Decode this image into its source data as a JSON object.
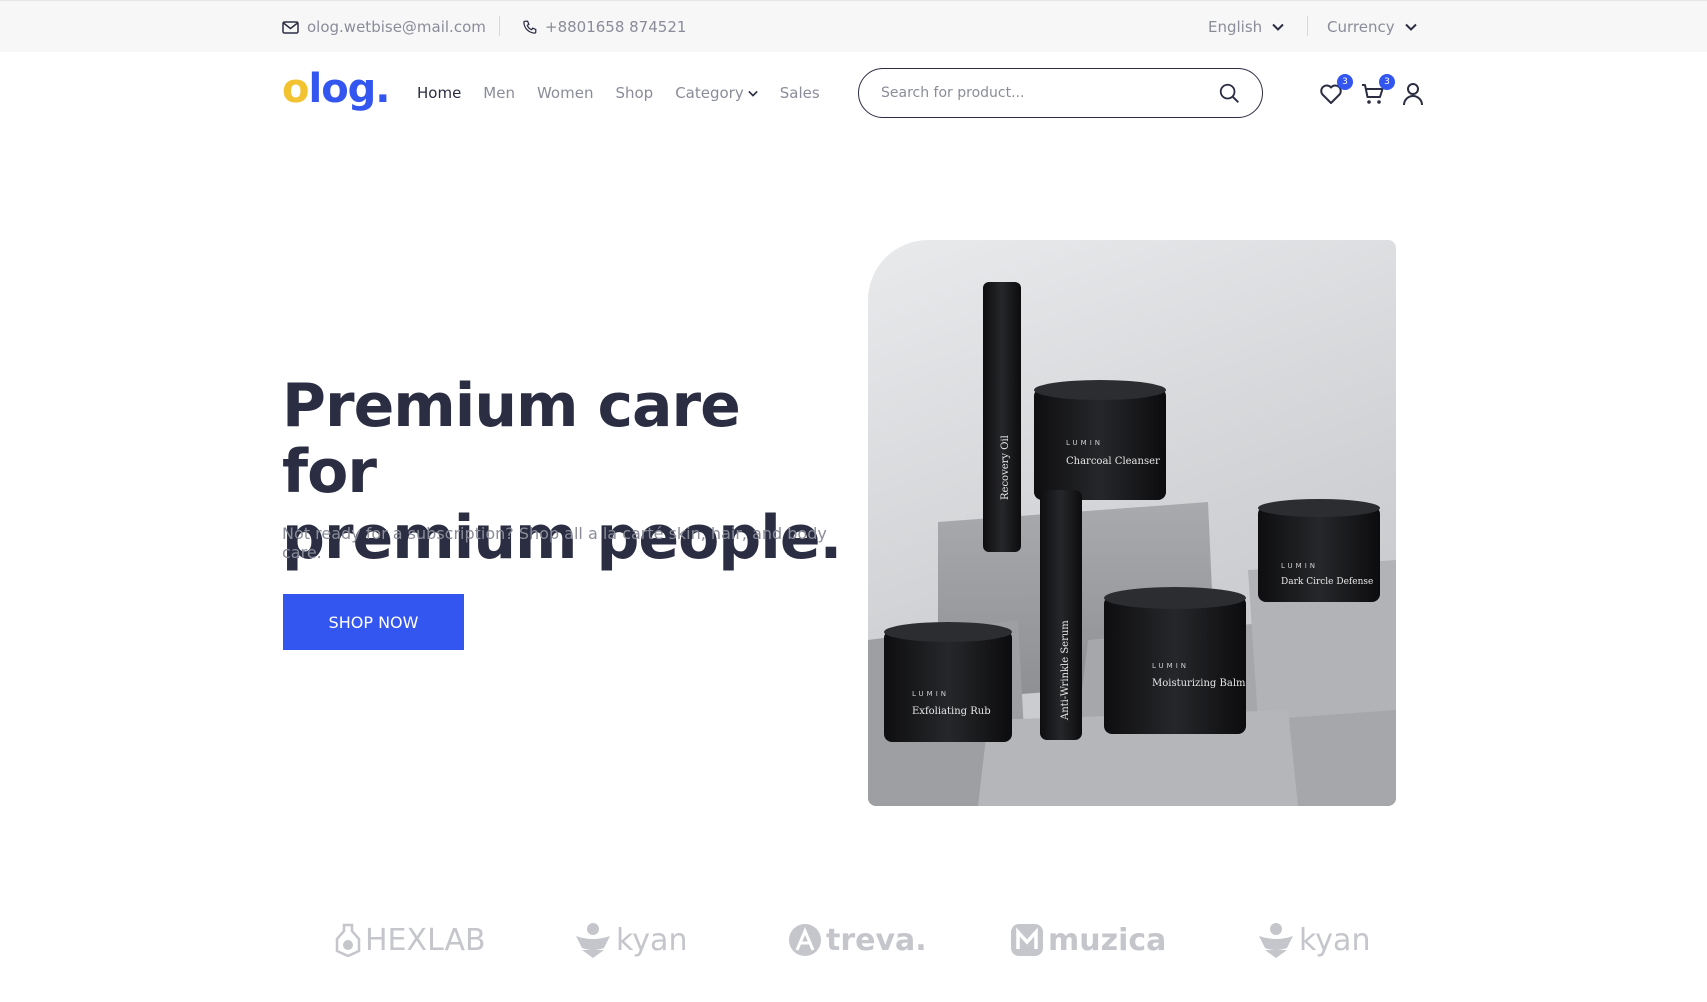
{
  "topbar": {
    "email": "olog.wetbise@mail.com",
    "phone": "+8801658 874521",
    "language": "English",
    "currency": "Currency"
  },
  "header": {
    "logo_first": "o",
    "logo_rest": "log.",
    "nav": [
      "Home",
      "Men",
      "Women",
      "Shop",
      "Category",
      "Sales"
    ],
    "search_placeholder": "Search for product...",
    "wishlist_count": "3",
    "cart_count": "3"
  },
  "hero": {
    "title_line1": "Premium care for",
    "title_line2": "premium people.",
    "subtitle": "Not ready for a subscription? Shop all a la carté skin, hair, and body care.",
    "cta": "SHOP NOW",
    "products": {
      "brand": "LUMIN",
      "items": [
        "Recovery Oil",
        "Charcoal Cleanser",
        "Dark Circle Defense",
        "Anti-Wrinkle Serum",
        "Moisturizing Balm",
        "Exfoliating Rub"
      ]
    }
  },
  "brands": [
    "HEXLAB",
    "kyan",
    "treva.",
    "muzica",
    "kyan"
  ],
  "colors": {
    "accent": "#3355f0",
    "logo_o": "#f2c230",
    "text_dark": "#2b2d42",
    "text_muted": "#8a8d99"
  }
}
